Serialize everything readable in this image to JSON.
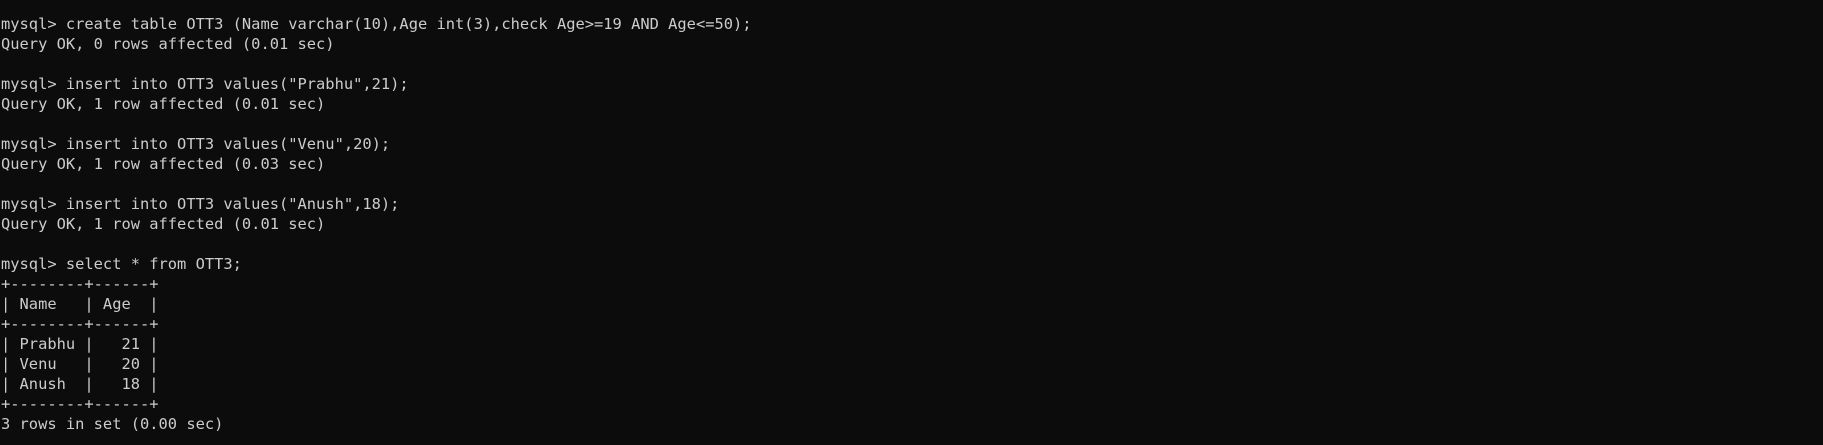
{
  "terminal": {
    "lines": [
      "mysql> create table OTT3 (Name varchar(10),Age int(3),check Age>=19 AND Age<=50);",
      "Query OK, 0 rows affected (0.01 sec)",
      "",
      "mysql> insert into OTT3 values(\"Prabhu\",21);",
      "Query OK, 1 row affected (0.01 sec)",
      "",
      "mysql> insert into OTT3 values(\"Venu\",20);",
      "Query OK, 1 row affected (0.03 sec)",
      "",
      "mysql> insert into OTT3 values(\"Anush\",18);",
      "Query OK, 1 row affected (0.01 sec)",
      "",
      "mysql> select * from OTT3;",
      "+--------+------+",
      "| Name   | Age  |",
      "+--------+------+",
      "| Prabhu |   21 |",
      "| Venu   |   20 |",
      "| Anush  |   18 |",
      "+--------+------+",
      "3 rows in set (0.00 sec)"
    ]
  }
}
